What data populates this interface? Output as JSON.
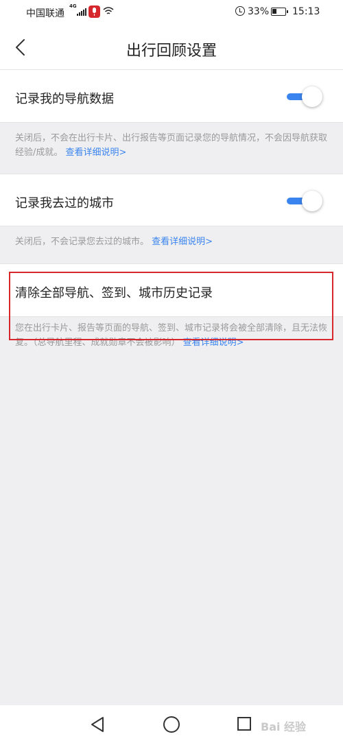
{
  "status_bar": {
    "carrier": "中国联通",
    "network": "4G",
    "battery": "33%",
    "time": "15:13"
  },
  "header": {
    "title": "出行回顾设置"
  },
  "settings": [
    {
      "label": "记录我的导航数据",
      "enabled": true,
      "description": "关闭后，不会在出行卡片、出行报告等页面记录您的导航情况，不会因导航获取经验/成就。",
      "link": "查看详细说明>"
    },
    {
      "label": "记录我去过的城市",
      "enabled": true,
      "description": "关闭后，不会记录您去过的城市。",
      "link": "查看详细说明>"
    }
  ],
  "clear_history": {
    "label": "清除全部导航、签到、城市历史记录",
    "description": "您在出行卡片、报告等页面的导航、签到、城市记录将会被全部清除，且无法恢复。（总导航里程、成就勋章不会被影响）",
    "link": "查看详细说明>"
  },
  "colors": {
    "accent": "#3a84f0",
    "highlight": "#d7262c"
  },
  "watermark": "Bai 经验"
}
